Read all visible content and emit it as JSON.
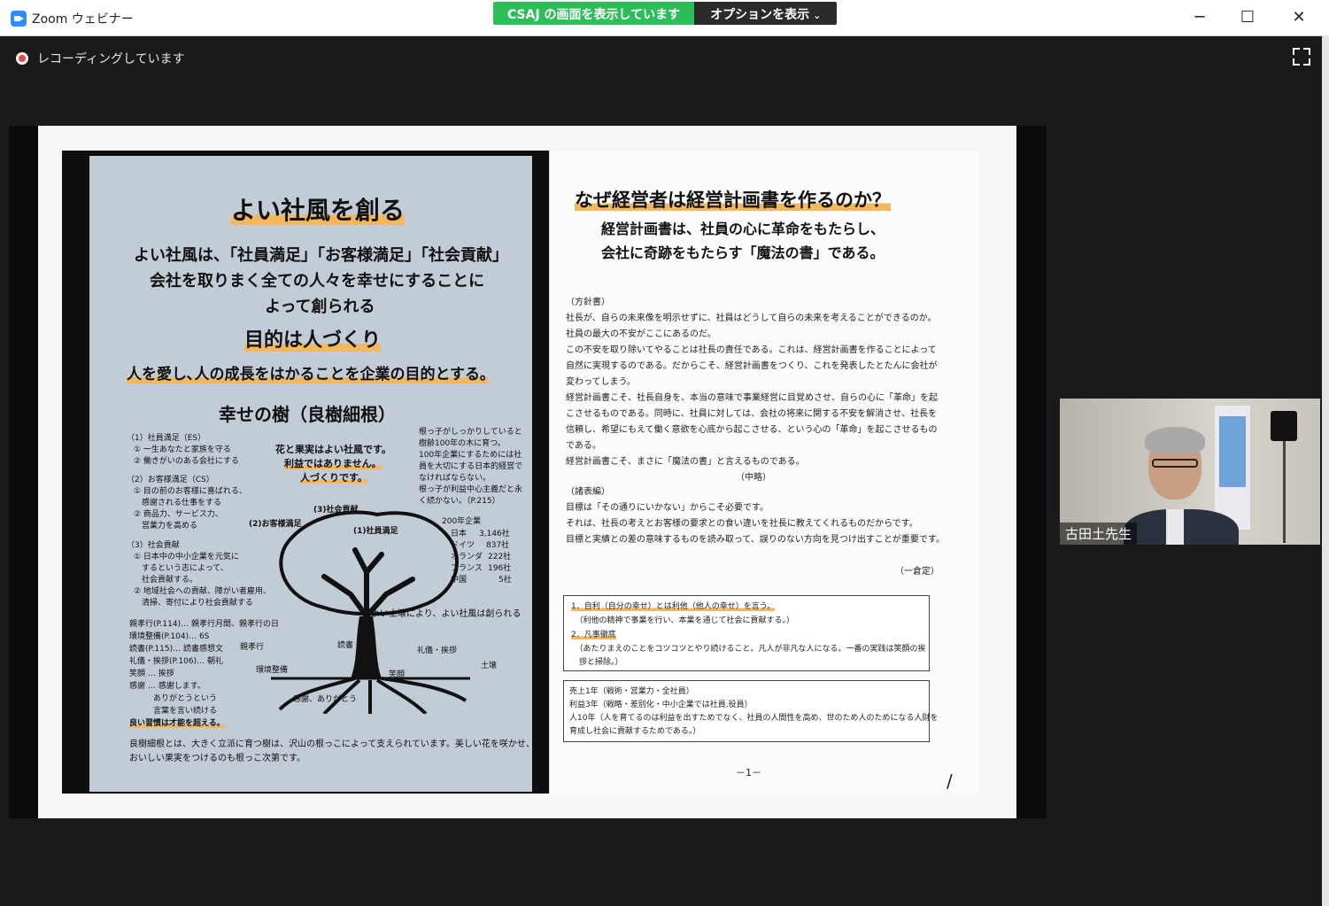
{
  "window": {
    "title": "Zoom ウェビナー",
    "minimize": "─",
    "maximize": "☐",
    "close": "✕"
  },
  "share_banner": {
    "status": "CSAJ の画面を表示しています",
    "options": "オプションを表示",
    "options_chevron": "⌄"
  },
  "recording": {
    "label": "レコーディングしています"
  },
  "left_page": {
    "title": "よい社風を創る",
    "lead": [
      "よい社風は、「社員満足」「お客様満足」「社会貢献」",
      "会社を取りまく全ての人々を幸せにすることに",
      "よって創られる"
    ],
    "subtitle": "目的は人づくり",
    "purpose": "人を愛し､人の成長をはかることを企業の目的とする｡",
    "tree_title": "幸せの樹（良樹細根）",
    "es_heading": "（1）社員満足（ES）",
    "es_items": [
      "① 一生あなたと家族を守る",
      "② 働きがいのある会社にする"
    ],
    "cs_heading": "（2）お客様満足（CS）",
    "cs_items": [
      "① 目の前のお客様に喜ばれる、",
      "　感謝される仕事をする",
      "② 商品力、サービス力、",
      "　営業力を高める"
    ],
    "sc_heading": "（3）社会貢献",
    "sc_items": [
      "① 日本中の中小企業を元気に",
      "　するという志によって、",
      "　社会貢献する。",
      "② 地域社会への貢献、障がい者雇用、",
      "　清掃、寄付により社会貢献する"
    ],
    "flower": [
      "花と果実はよい社風です。",
      "利益ではありません。",
      "人づくりです。"
    ],
    "roots_note": [
      "根っ子がしっかりしていると",
      "樹齢100年の木に育つ。",
      "100年企業にするためには社",
      "員を大切にする日本的経営で",
      "なければならない。",
      "根っ子が利益中心主義だと永",
      "く続かない。（P.215）"
    ],
    "century_heading": "200年企業",
    "century": [
      {
        "country": "日本",
        "count": "3,146社"
      },
      {
        "country": "ドイツ",
        "count": "837社"
      },
      {
        "country": "オランダ",
        "count": "222社"
      },
      {
        "country": "フランス",
        "count": "196社"
      },
      {
        "country": "中国",
        "count": "5社"
      }
    ],
    "soil_note": "よい土壌により、よい社風は創られる",
    "tree_labels": {
      "sc": "(3)社会貢献",
      "cs": "(2)お客様満足",
      "es": "(1)社員満足"
    },
    "root_labels": [
      "親孝行",
      "読書",
      "礼儀・挨拶",
      "土壌",
      "環境整備",
      "笑顔",
      "感謝、ありがとう"
    ],
    "habits": [
      "親孝行(P.114)… 親孝行月間、親孝行の日",
      "環境整備(P.104)… 6S",
      "読書(P.115)… 読書感想文",
      "礼儀・挨拶(P.106)… 朝礼",
      "笑顔 … 挨拶",
      "感謝 … 感謝します。",
      "　　　ありがとうという",
      "　　　言葉を言い続ける",
      "良い習慣は才能を超える。"
    ],
    "footer": [
      "良樹細根とは、大きく立派に育つ樹は、沢山の根っこによって支えられています。美しい花を咲かせ、",
      "おいしい果実をつけるのも根っこ次第です。"
    ]
  },
  "right_page": {
    "title": "なぜ経営者は経営計画書を作るのか？",
    "subtitle": [
      "経営計画書は、社員の心に革命をもたらし、",
      "会社に奇跡をもたらす「魔法の書」である。"
    ],
    "policy_heading": "（方針書）",
    "paragraphs": [
      "社長が、自らの未来像を明示せずに、社員はどうして自らの未来を考えることができるのか。",
      "社員の最大の不安がここにあるのだ。",
      "この不安を取り除いてやることは社長の責任である。これは、経営計画書を作ることによって",
      "自然に実現するのである。だからこそ、経営計画書をつくり、これを発表したとたんに会社が",
      "変わってしまう。",
      "経営計画書こそ、社長自身を、本当の意味で事業経営に目覚めさせ、自らの心に「革命」を起",
      "こさせるものである。同時に、社員に対しては、会社の将来に関する不安を解消させ、社長を",
      "信頼し、希望にもえて働く意欲を心底から起こさせる、という心の「革命」を起こさせるもの",
      "である。",
      "経営計画書こそ、まさに「魔法の書」と言えるものである。"
    ],
    "omitted": "（中略）",
    "table_heading": "（諸表編）",
    "paragraphs2": [
      "目標は「その通りにいかない」からこそ必要です。",
      "それは、社長の考えとお客様の要求との食い違いを社長に教えてくれるものだからです。",
      "目標と実績との差の意味するものを読み取って、誤りのない方向を見つけ出すことが重要です。"
    ],
    "author": "（一倉定）",
    "box1": [
      "1．自利（自分の幸せ）とは利他（他人の幸せ）を言う。",
      "　（利他の精神で事業を行い、本業を通じて社会に貢献する。）",
      "2．凡事徹底",
      "　（あたりまえのことをコツコツとやり続けること。凡人が非凡な人になる。一番の実践は笑顔の挨",
      "　拶と掃除。）"
    ],
    "box2": [
      "売上1年（戦術・営業力・全社員）",
      "利益3年（戦略・差別化・中小企業では社員,役員）",
      "人10年（人を育てるのは利益を出すためでなく、社員の人間性を高め、世のため人のためになる人財を",
      "育成し社会に貢献するためである。）"
    ],
    "page_number": "－1－",
    "mark": "/"
  },
  "video": {
    "name": "古田土先生"
  }
}
